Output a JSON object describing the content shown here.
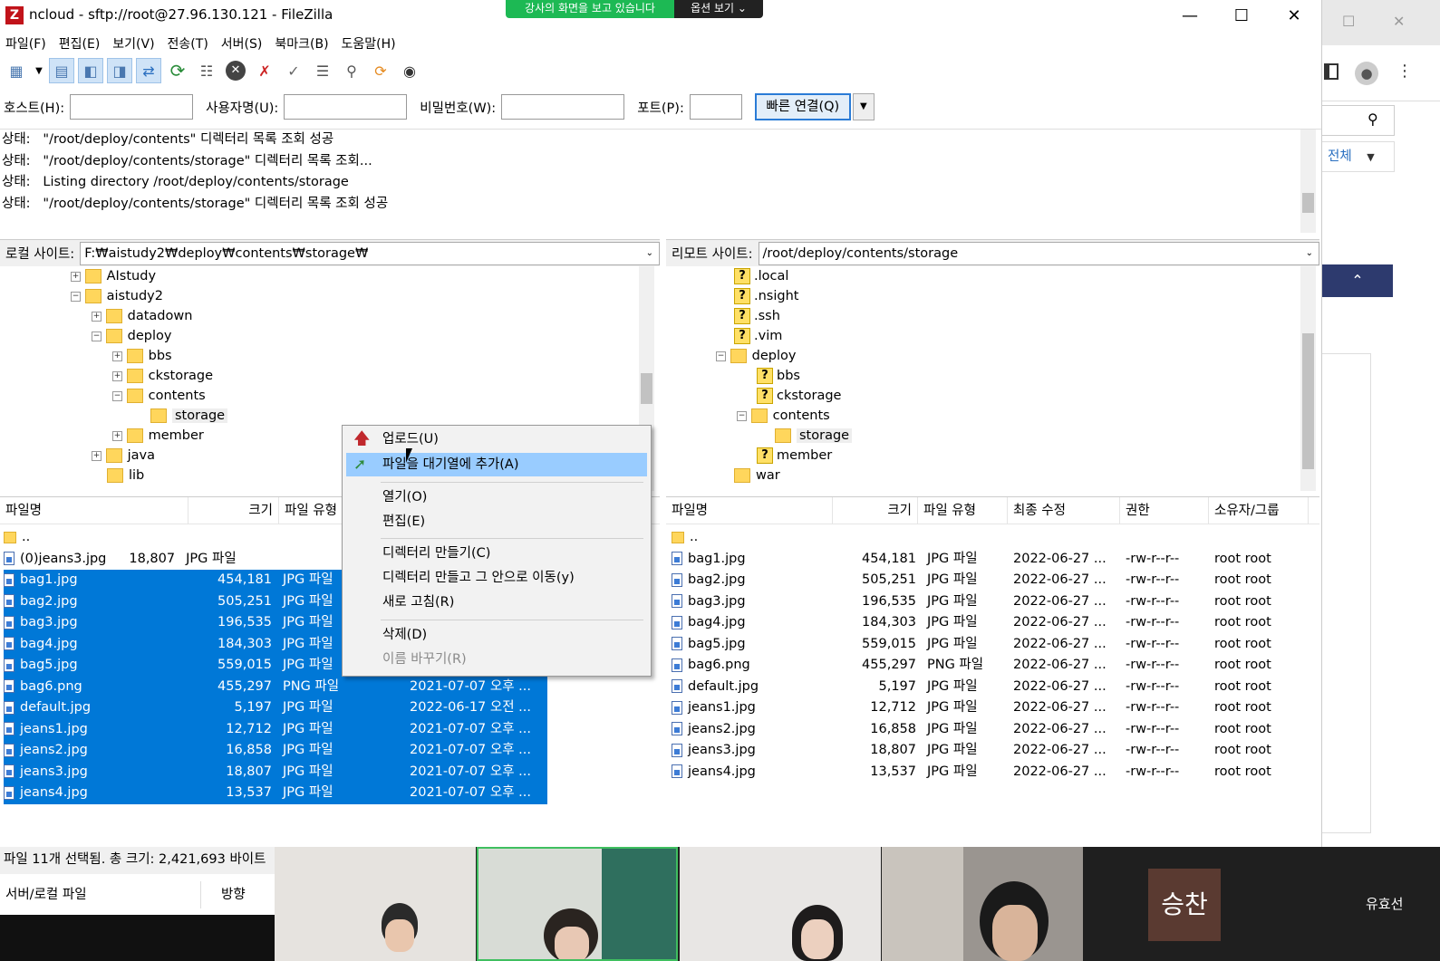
{
  "window": {
    "app_icon": "Z",
    "title": "ncloud - sftp://root@27.96.130.121 - FileZilla"
  },
  "share_banner": {
    "text": "강사의 화면을 보고 있습니다",
    "options": "옵션 보기 ⌄"
  },
  "menu": [
    "파일(F)",
    "편집(E)",
    "보기(V)",
    "전송(T)",
    "서버(S)",
    "북마크(B)",
    "도움말(H)"
  ],
  "quickconnect": {
    "host_label": "호스트(H):",
    "user_label": "사용자명(U):",
    "pass_label": "비밀번호(W):",
    "port_label": "포트(P):",
    "button": "빠른 연결(Q)"
  },
  "log": [
    {
      "prefix": "상태:",
      "text": "\"/root/deploy/contents\" 디렉터리 목록 조회 성공"
    },
    {
      "prefix": "상태:",
      "text": "\"/root/deploy/contents/storage\" 디렉터리 목록 조회..."
    },
    {
      "prefix": "상태:",
      "text": "Listing directory /root/deploy/contents/storage"
    },
    {
      "prefix": "상태:",
      "text": "\"/root/deploy/contents/storage\" 디렉터리 목록 조회 성공"
    }
  ],
  "local": {
    "label": "로컬 사이트:",
    "path": "F:₩aistudy2₩deploy₩contents₩storage₩",
    "tree": [
      "AIstudy",
      "aistudy2",
      "datadown",
      "deploy",
      "bbs",
      "ckstorage",
      "contents",
      "storage",
      "member",
      "java",
      "lib"
    ],
    "headers": [
      "파일명",
      "크기",
      "파일 유형"
    ],
    "files": [
      {
        "name": "..",
        "size": "",
        "type": "",
        "date": ""
      },
      {
        "name": "(0)jeans3.jpg",
        "size": "18,807",
        "type": "JPG 파일",
        "date": ""
      },
      {
        "name": "bag1.jpg",
        "size": "454,181",
        "type": "JPG 파일",
        "date": ""
      },
      {
        "name": "bag2.jpg",
        "size": "505,251",
        "type": "JPG 파일",
        "date": ""
      },
      {
        "name": "bag3.jpg",
        "size": "196,535",
        "type": "JPG 파일",
        "date": ""
      },
      {
        "name": "bag4.jpg",
        "size": "184,303",
        "type": "JPG 파일",
        "date": ""
      },
      {
        "name": "bag5.jpg",
        "size": "559,015",
        "type": "JPG 파일",
        "date": ""
      },
      {
        "name": "bag6.png",
        "size": "455,297",
        "type": "PNG 파일",
        "date": "2021-07-07 오후 ..."
      },
      {
        "name": "default.jpg",
        "size": "5,197",
        "type": "JPG 파일",
        "date": "2022-06-17 오전 ..."
      },
      {
        "name": "jeans1.jpg",
        "size": "12,712",
        "type": "JPG 파일",
        "date": "2021-07-07 오후 ..."
      },
      {
        "name": "jeans2.jpg",
        "size": "16,858",
        "type": "JPG 파일",
        "date": "2021-07-07 오후 ..."
      },
      {
        "name": "jeans3.jpg",
        "size": "18,807",
        "type": "JPG 파일",
        "date": "2021-07-07 오후 ..."
      },
      {
        "name": "jeans4.jpg",
        "size": "13,537",
        "type": "JPG 파일",
        "date": "2021-07-07 오후 ..."
      }
    ],
    "status": "파일 11개 선택됨. 총 크기: 2,421,693 바이트"
  },
  "remote": {
    "label": "리모트 사이트:",
    "path": "/root/deploy/contents/storage",
    "tree": [
      ".local",
      ".nsight",
      ".ssh",
      ".vim",
      "deploy",
      "bbs",
      "ckstorage",
      "contents",
      "storage",
      "member",
      "war"
    ],
    "headers": [
      "파일명",
      "크기",
      "파일 유형",
      "최종 수정",
      "권한",
      "소유자/그룹"
    ],
    "files": [
      {
        "name": "..",
        "size": "",
        "type": "",
        "date": "",
        "perm": "",
        "owner": ""
      },
      {
        "name": "bag1.jpg",
        "size": "454,181",
        "type": "JPG 파일",
        "date": "2022-06-27 ...",
        "perm": "-rw-r--r--",
        "owner": "root root"
      },
      {
        "name": "bag2.jpg",
        "size": "505,251",
        "type": "JPG 파일",
        "date": "2022-06-27 ...",
        "perm": "-rw-r--r--",
        "owner": "root root"
      },
      {
        "name": "bag3.jpg",
        "size": "196,535",
        "type": "JPG 파일",
        "date": "2022-06-27 ...",
        "perm": "-rw-r--r--",
        "owner": "root root"
      },
      {
        "name": "bag4.jpg",
        "size": "184,303",
        "type": "JPG 파일",
        "date": "2022-06-27 ...",
        "perm": "-rw-r--r--",
        "owner": "root root"
      },
      {
        "name": "bag5.jpg",
        "size": "559,015",
        "type": "JPG 파일",
        "date": "2022-06-27 ...",
        "perm": "-rw-r--r--",
        "owner": "root root"
      },
      {
        "name": "bag6.png",
        "size": "455,297",
        "type": "PNG 파일",
        "date": "2022-06-27 ...",
        "perm": "-rw-r--r--",
        "owner": "root root"
      },
      {
        "name": "default.jpg",
        "size": "5,197",
        "type": "JPG 파일",
        "date": "2022-06-27 ...",
        "perm": "-rw-r--r--",
        "owner": "root root"
      },
      {
        "name": "jeans1.jpg",
        "size": "12,712",
        "type": "JPG 파일",
        "date": "2022-06-27 ...",
        "perm": "-rw-r--r--",
        "owner": "root root"
      },
      {
        "name": "jeans2.jpg",
        "size": "16,858",
        "type": "JPG 파일",
        "date": "2022-06-27 ...",
        "perm": "-rw-r--r--",
        "owner": "root root"
      },
      {
        "name": "jeans3.jpg",
        "size": "18,807",
        "type": "JPG 파일",
        "date": "2022-06-27 ...",
        "perm": "-rw-r--r--",
        "owner": "root root"
      },
      {
        "name": "jeans4.jpg",
        "size": "13,537",
        "type": "JPG 파일",
        "date": "2022-06-27 ...",
        "perm": "-rw-r--r--",
        "owner": "root root"
      }
    ]
  },
  "context_menu": {
    "upload": "업로드(U)",
    "add_queue": "파일을 대기열에 추가(A)",
    "open": "열기(O)",
    "edit": "편집(E)",
    "mkdir": "디렉터리 만들기(C)",
    "mkdir_enter": "디렉터리 만들고 그 안으로 이동(y)",
    "refresh": "새로 고침(R)",
    "delete": "삭제(D)",
    "rename": "이름 바꾸기(R)"
  },
  "queue": {
    "col1": "서버/로컬 파일",
    "col2": "방향"
  },
  "browser": {
    "filter": "전체"
  },
  "video": {
    "avatar_text": "승찬",
    "name": "유효선"
  },
  "colors": {
    "selection": "#0078d7",
    "menu_highlight": "#99ccff",
    "banner": "#1db954",
    "folder": "#ffd65c"
  }
}
